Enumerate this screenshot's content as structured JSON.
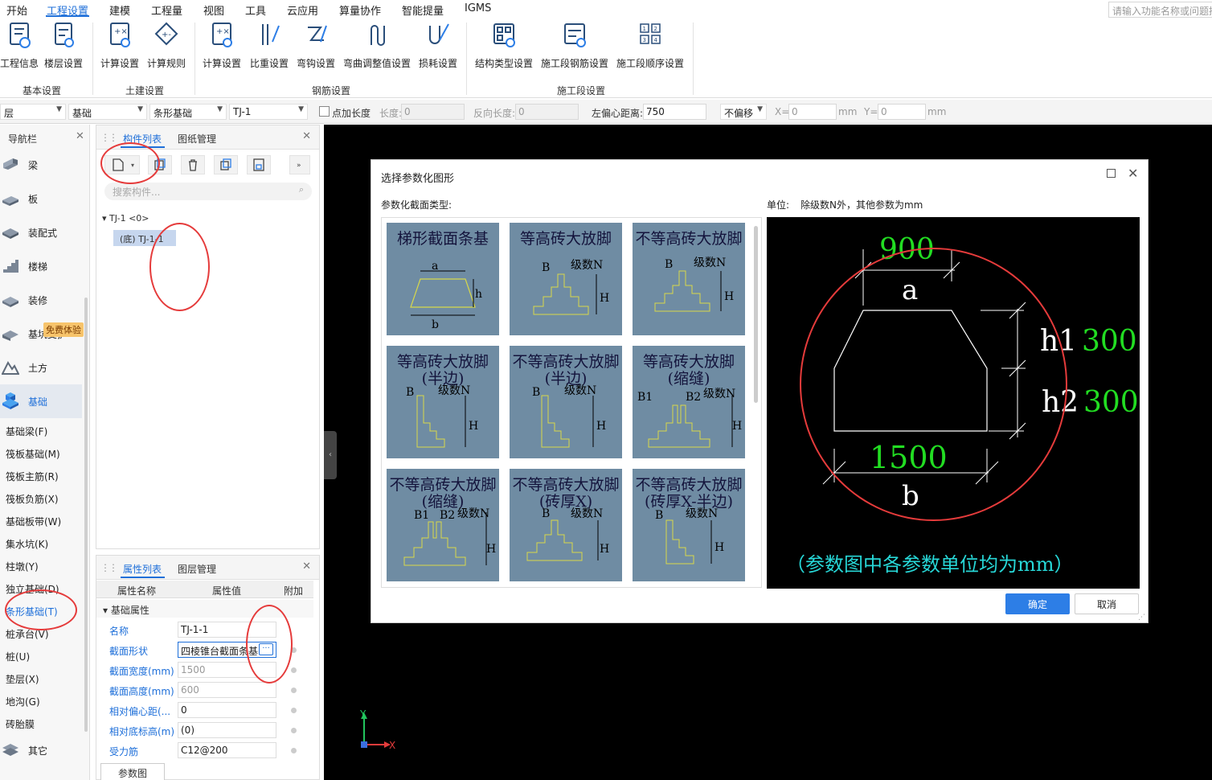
{
  "menu": {
    "items": [
      "开始",
      "工程设置",
      "建模",
      "工程量",
      "视图",
      "工具",
      "云应用",
      "算量协作",
      "智能提量",
      "IGMS"
    ],
    "active": "工程设置",
    "search_placeholder": "请输入功能名称或问题描述"
  },
  "ribbon": {
    "buttons": [
      "工程信息",
      "楼层设置",
      "计算设置",
      "计算规则",
      "计算设置",
      "比重设置",
      "弯钩设置",
      "弯曲调整值设置",
      "损耗设置",
      "结构类型设置",
      "施工段钢筋设置",
      "施工段顺序设置"
    ],
    "groups": [
      "基本设置",
      "土建设置",
      "钢筋设置",
      "施工段设置"
    ]
  },
  "toolbar": {
    "floor": "层",
    "category": "基础",
    "type": "条形基础",
    "element": "TJ-1",
    "add_length_label": "点加长度",
    "length_label": "长度:",
    "length_value": "0",
    "reverse_length_label": "反向长度:",
    "reverse_length_value": "0",
    "left_offset_label": "左偏心距离:",
    "left_offset_value": "750",
    "offset_mode": "不偏移",
    "x_label": "X=",
    "x_value": "0",
    "y_label": "Y=",
    "y_value": "0",
    "unit": "mm"
  },
  "nav": {
    "title": "导航栏",
    "items": [
      "梁",
      "板",
      "装配式",
      "楼梯",
      "装修",
      "基坑支护",
      "土方",
      "基础"
    ],
    "active": "基础",
    "trial_badge": "免费体验",
    "sub_items": [
      "基础梁(F)",
      "筏板基础(M)",
      "筏板主筋(R)",
      "筏板负筋(X)",
      "基础板带(W)",
      "集水坑(K)",
      "柱墩(Y)",
      "独立基础(D)",
      "条形基础(T)",
      "桩承台(V)",
      "桩(U)",
      "垫层(X)",
      "地沟(G)",
      "砖胎膜"
    ],
    "active_sub": "条形基础(T)",
    "other": "其它"
  },
  "component_panel": {
    "tabs": [
      "构件列表",
      "图纸管理"
    ],
    "search_placeholder": "搜索构件...",
    "tree_root": "TJ-1 <0>",
    "tree_leaf": "(底) TJ-1-1"
  },
  "property_panel": {
    "tabs": [
      "属性列表",
      "图层管理"
    ],
    "col_name": "属性名称",
    "col_value": "属性值",
    "col_extra": "附加",
    "group": "基础属性",
    "rows": [
      {
        "name": "名称",
        "value": "TJ-1-1"
      },
      {
        "name": "截面形状",
        "value": "四棱锥台截面条基"
      },
      {
        "name": "截面宽度(mm)",
        "value": "1500"
      },
      {
        "name": "截面高度(mm)",
        "value": "600"
      },
      {
        "name": "相对偏心距(...",
        "value": "0"
      },
      {
        "name": "相对底标高(m)",
        "value": "(0)"
      },
      {
        "name": "受力筋",
        "value": "C12@200"
      }
    ],
    "bottom_tab": "参数图"
  },
  "dialog": {
    "title": "选择参数化图形",
    "type_label": "参数化截面类型:",
    "unit_label": "单位:",
    "unit_text": "除级数N外，其他参数为mm",
    "shapes": [
      {
        "title": "梯形截面条基",
        "labels": [
          "a",
          "h",
          "b"
        ]
      },
      {
        "title": "等高砖大放脚",
        "labels": [
          "B",
          "级数N",
          "H"
        ]
      },
      {
        "title": "不等高砖大放脚",
        "labels": [
          "B",
          "级数N",
          "H"
        ]
      },
      {
        "title": "等高砖大放脚(半边)",
        "labels": [
          "B",
          "级数N",
          "H"
        ]
      },
      {
        "title": "不等高砖大放脚(半边)",
        "labels": [
          "B",
          "级数N",
          "H"
        ]
      },
      {
        "title": "等高砖大放脚(缩缝)",
        "labels": [
          "B1",
          "B2",
          "级数N",
          "H"
        ]
      },
      {
        "title": "不等高砖大放脚(缩缝)",
        "labels": [
          "B1",
          "B2",
          "级数N",
          "H"
        ]
      },
      {
        "title": "不等高砖大放脚(砖厚X)",
        "labels": [
          "B",
          "级数N",
          "H"
        ]
      },
      {
        "title": "不等高砖大放脚(砖厚X-半边)",
        "labels": [
          "B",
          "级数N",
          "H"
        ]
      }
    ],
    "preview": {
      "a_value": "900",
      "a_label": "a",
      "h1_label": "h1",
      "h1_value": "300",
      "h2_label": "h2",
      "h2_value": "300",
      "b_value": "1500",
      "b_label": "b",
      "note": "（参数图中各参数单位均为mm）"
    },
    "ok": "确定",
    "cancel": "取消"
  },
  "axis": {
    "x": "X",
    "y": "Y"
  },
  "colors": {
    "accent": "#1e6fd9",
    "cell_bg": "#6f8ca3",
    "preview_value": "#22dd22",
    "preview_note": "#27d7d7",
    "annotation": "#e53b3b"
  }
}
